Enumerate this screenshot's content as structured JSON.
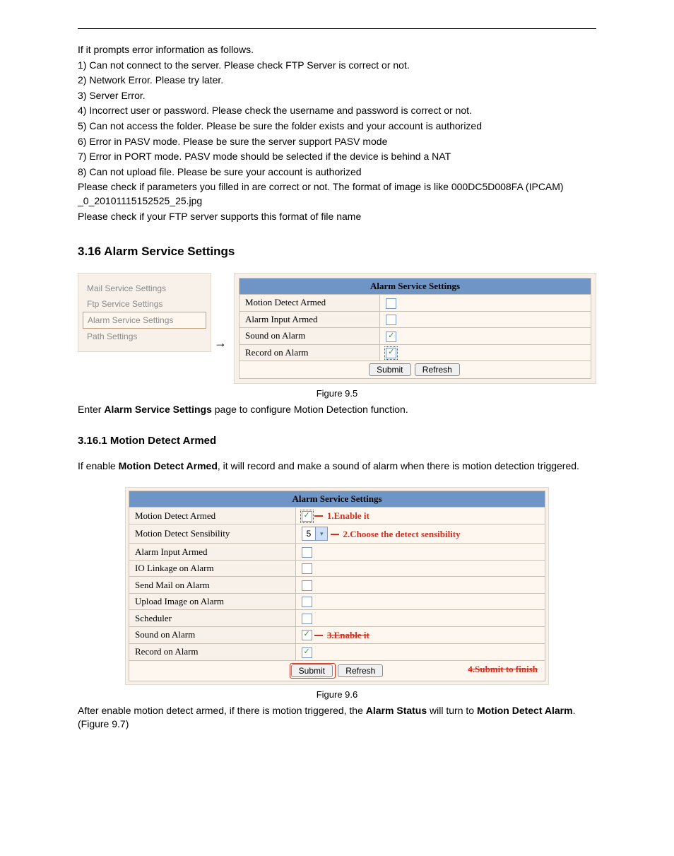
{
  "intro": {
    "l0": "If it prompts error information as follows.",
    "l1": "1) Can not connect to the server. Please check FTP Server is correct or not.",
    "l2": "2) Network Error. Please try later.",
    "l3": "3) Server Error.",
    "l4": "4) Incorrect user or password. Please check the username and password is correct or not.",
    "l5": "5) Can not access the folder. Please be sure the folder exists and your account is authorized",
    "l6": "6) Error in PASV mode. Please be sure the server support PASV mode",
    "l7": "7) Error in PORT mode. PASV mode should be selected if the device is behind a NAT",
    "l8": "8) Can not upload file. Please be sure your account is authorized",
    "l9": "Please check if parameters you filled in are correct or not. The format of image is like 000DC5D008FA (IPCAM) _0_20101115152525_25.jpg",
    "l10": "Please check if your FTP server supports this format of file name"
  },
  "headings": {
    "h316": "3.16 Alarm Service Settings",
    "h3161": "3.16.1 Motion Detect Armed"
  },
  "sidebar": {
    "items": {
      "0": "Mail Service Settings",
      "1": "Ftp Service Settings",
      "2": "Alarm Service Settings",
      "3": "Path Settings"
    }
  },
  "panel95": {
    "title": "Alarm Service Settings",
    "rows": {
      "0": "Motion Detect Armed",
      "1": "Alarm Input Armed",
      "2": "Sound on Alarm",
      "3": "Record on Alarm"
    },
    "submit": "Submit",
    "refresh": "Refresh",
    "caption": "Figure 9.5"
  },
  "text95_before": "Enter ",
  "text95_bold": "Alarm Service Settings",
  "text95_after": " page to configure Motion Detection function.",
  "text3161_before": "If enable ",
  "text3161_bold": "Motion Detect Armed",
  "text3161_after": ", it will record and make a sound of alarm when there is motion detection triggered.",
  "panel96": {
    "title": "Alarm Service Settings",
    "rows": {
      "0": "Motion Detect Armed",
      "1": "Motion Detect Sensibility",
      "2": "Alarm Input Armed",
      "3": "IO Linkage on Alarm",
      "4": "Send Mail on Alarm",
      "5": "Upload Image on Alarm",
      "6": "Scheduler",
      "7": "Sound on Alarm",
      "8": "Record on Alarm"
    },
    "sens_value": "5",
    "submit": "Submit",
    "refresh": "Refresh",
    "anno1": "1.Enable it",
    "anno2": "2.Choose the detect sensibility",
    "anno3": "3.Enable it",
    "anno4": "4.Submit to finish",
    "caption": "Figure 9.6"
  },
  "outro_before": "After enable motion detect armed, if there is motion triggered, the ",
  "outro_bold1": "Alarm Status",
  "outro_mid": " will turn to ",
  "outro_bold2": "Motion Detect Alarm",
  "outro_after": ". (Figure 9.7)",
  "arrow": "→",
  "check_glyph": "✓"
}
